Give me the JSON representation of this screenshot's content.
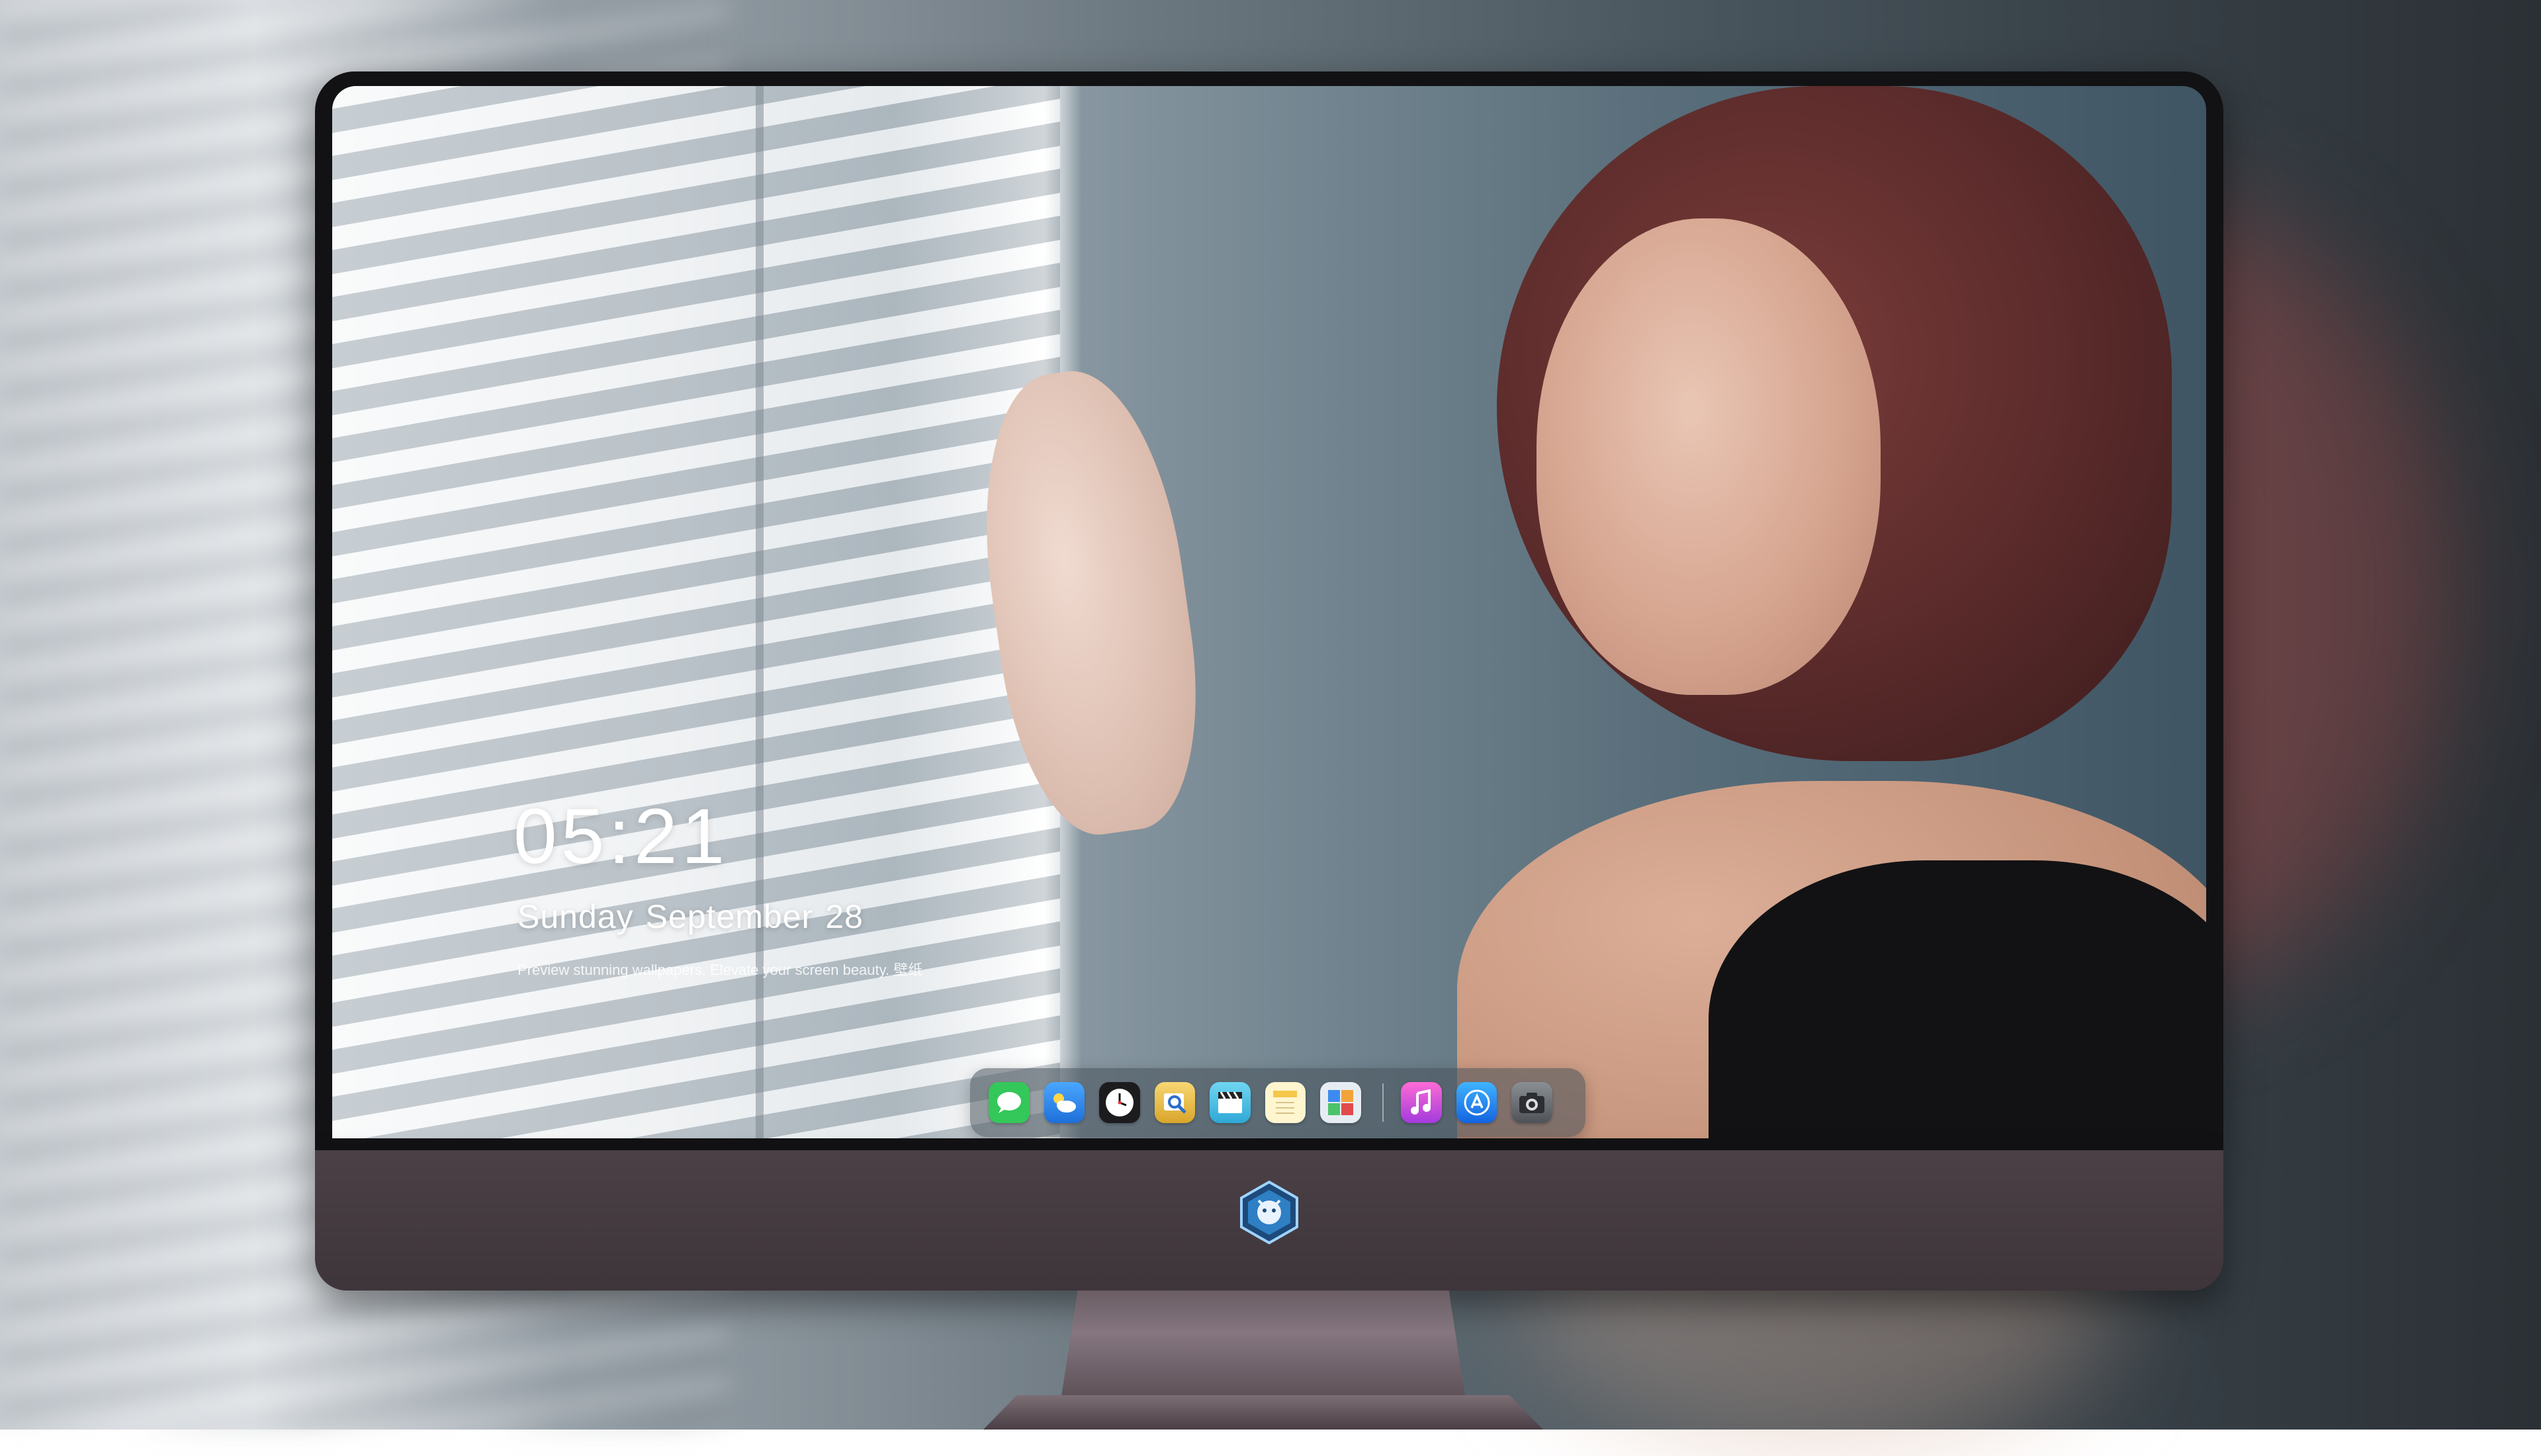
{
  "lockscreen": {
    "time": "05:21",
    "weekday": "Sunday",
    "month": "September",
    "day": "28",
    "tagline": "Preview stunning wallpapers. Elevate your screen beauty. 壁纸"
  },
  "dock": {
    "apps": [
      {
        "name": "messages-icon",
        "glyph": "💬",
        "color": "#34c759"
      },
      {
        "name": "weather-icon",
        "glyph": "☁",
        "color": "#2e8ff0"
      },
      {
        "name": "clock-icon",
        "glyph": "◷",
        "color": "#1c1c1e"
      },
      {
        "name": "preview-icon",
        "glyph": "🔍",
        "color": "#f2c94c"
      },
      {
        "name": "clapper-icon",
        "glyph": "🎬",
        "color": "#4fc3e8"
      },
      {
        "name": "notes-icon",
        "glyph": "≡",
        "color": "#f7d774"
      },
      {
        "name": "photo-editor-icon",
        "glyph": "▦",
        "color": "#dfe6ec"
      }
    ],
    "pinned": [
      {
        "name": "music-icon",
        "glyph": "♫",
        "color": "#e84ec9"
      },
      {
        "name": "app-store-icon",
        "glyph": "Ⓐ",
        "color": "#1e8ef7"
      },
      {
        "name": "camera-icon",
        "glyph": "◉",
        "color": "#6b6f73"
      }
    ]
  },
  "colors": {
    "bezel": "#121214",
    "chin": "#4a4046",
    "clock_text": "#ffffff"
  }
}
